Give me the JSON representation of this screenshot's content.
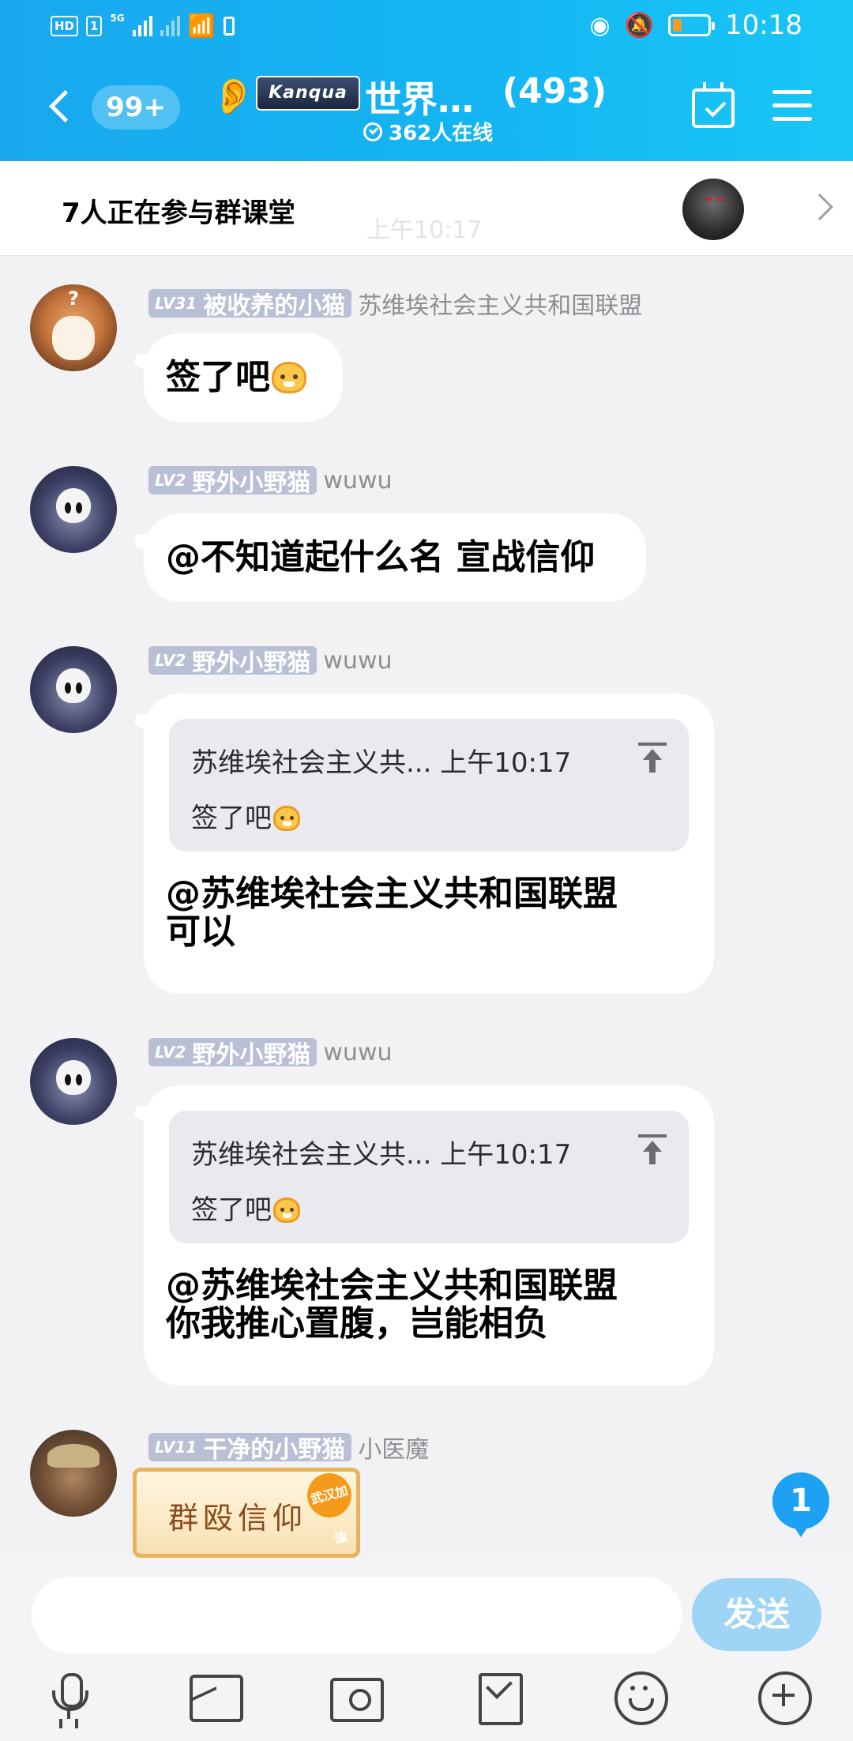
{
  "status_bar": {
    "hd_label": "HD",
    "sim_label": "1",
    "network_label": "5G",
    "time": "10:18",
    "battery_level": 0.26
  },
  "header": {
    "unread_count": "99+",
    "group_logo_text": "Kanqua",
    "group_name": "世界…",
    "member_count": "(493)",
    "online_text": "362人在线"
  },
  "banner": {
    "text": "7人正在参与群课堂",
    "timestamp": "上午10:17"
  },
  "messages": [
    {
      "level": "LV31",
      "title": "被收养的小猫",
      "nickname": "苏维埃社会主义共和国联盟",
      "text": "签了吧",
      "emoji": "yellow-cat-emoji"
    },
    {
      "level": "LV2",
      "title": "野外小野猫",
      "nickname": "wuwu",
      "text": "@不知道起什么名 宣战信仰"
    },
    {
      "level": "LV2",
      "title": "野外小野猫",
      "nickname": "wuwu",
      "quote_head": "苏维埃社会主义共... 上午10:17",
      "quote_text": "签了吧",
      "text_line1": "@苏维埃社会主义共和国联盟",
      "text_line2": "可以"
    },
    {
      "level": "LV2",
      "title": "野外小野猫",
      "nickname": "wuwu",
      "quote_head": "苏维埃社会主义共... 上午10:17",
      "quote_text": "签了吧",
      "text_line1": "@苏维埃社会主义共和国联盟",
      "text_line2": "你我推心置腹，岂能相负"
    },
    {
      "level": "LV11",
      "title": "干净的小野猫",
      "nickname": "小医魔",
      "sticker_text": "群殴信仰",
      "sticker_tag": "武汉加油"
    }
  ],
  "new_message_badge": "1",
  "input": {
    "placeholder": "",
    "value": "",
    "send_label": "发送"
  },
  "toolbar_icons": [
    "microphone-icon",
    "photo-icon",
    "camera-icon",
    "red-packet-icon",
    "emoji-icon",
    "plus-icon"
  ],
  "colors": {
    "header_start": "#19a8ee",
    "header_end": "#19c7f6",
    "badge": "#b9bfd4",
    "send_button": "#9ed4f6",
    "float_badge": "#1da1f2"
  }
}
